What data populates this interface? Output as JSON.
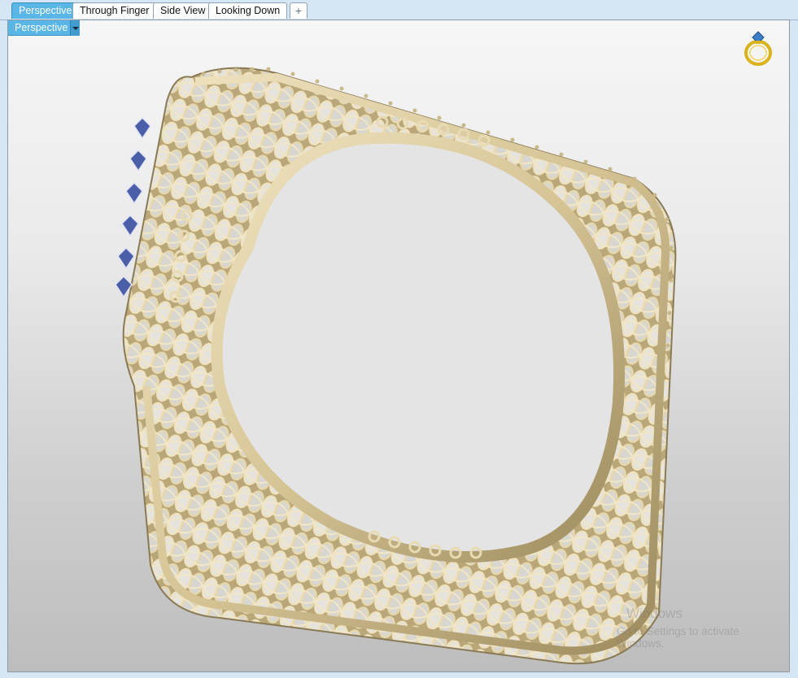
{
  "tabs": [
    {
      "label": "Perspective",
      "active": true
    },
    {
      "label": "Through Finger",
      "active": false
    },
    {
      "label": "Side View",
      "active": false
    },
    {
      "label": "Looking Down",
      "active": false
    }
  ],
  "add_tab_icon": "plus-icon",
  "viewport": {
    "view_label": "Perspective",
    "dropdown_icon": "chevron-down-icon",
    "corner_icon": "ring-icon"
  },
  "watermark": {
    "title": "Windows",
    "subtitle": "Go to Settings to activate Windows."
  },
  "colors": {
    "active_tab": "#59b6e6",
    "metal": "#d8c9a0",
    "metal_dark": "#8a7a55",
    "gem": "#4a5fa8"
  }
}
